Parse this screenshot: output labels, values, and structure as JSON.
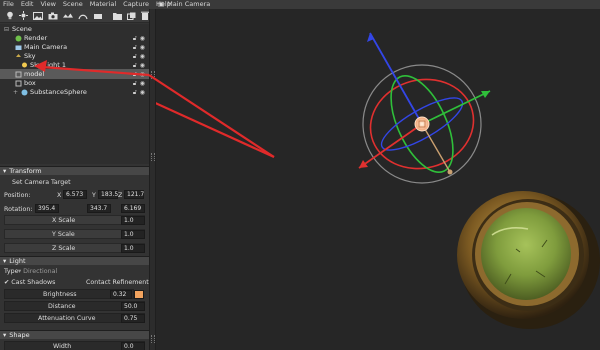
{
  "menu": [
    "File",
    "Edit",
    "View",
    "Scene",
    "Material",
    "Capture",
    "Help"
  ],
  "viewport": {
    "title": "Main Camera"
  },
  "tree": {
    "items": [
      {
        "label": "Scene"
      },
      {
        "label": "Render"
      },
      {
        "label": "Main Camera"
      },
      {
        "label": "Sky"
      },
      {
        "label": "Sky Light 1"
      },
      {
        "label": "model"
      },
      {
        "label": "box"
      },
      {
        "label": "SubstanceSphere"
      }
    ]
  },
  "transform": {
    "header": "Transform",
    "set_camera_target": "Set Camera Target",
    "position_label": "Position:",
    "rotation_label": "Rotation:",
    "x": "X",
    "y": "Y",
    "z": "Z",
    "position": [
      "6.573",
      "183.5",
      "121.7"
    ],
    "rotation": [
      "395.4",
      "343.7",
      "6.169"
    ],
    "scale_rows": [
      {
        "label": "X Scale",
        "value": "1.0"
      },
      {
        "label": "Y Scale",
        "value": "1.0"
      },
      {
        "label": "Z Scale",
        "value": "1.0"
      }
    ]
  },
  "light": {
    "header": "Light",
    "type_label": "Type",
    "type_value": "Directional",
    "cast_shadows": "Cast Shadows",
    "contact_refinement": "Contact Refinement",
    "brightness_label": "Brightness",
    "brightness_value": "0.32",
    "distance_label": "Distance",
    "distance_value": "50.0",
    "attenuation_label": "Attenuation Curve",
    "attenuation_value": "0.75",
    "swatch_color": "#f2a35e"
  },
  "shape": {
    "header": "Shape",
    "width_label": "Width",
    "width_value": "0.0"
  },
  "colors": {
    "gizmo_x": "#e0302f",
    "gizmo_y": "#2fbf3a",
    "gizmo_z": "#3346e6",
    "annotation_arrow": "#e02a2a"
  },
  "icons": [
    "light-bulb-icon",
    "light-icon",
    "photo-icon",
    "camera-icon",
    "move-icon",
    "rotate-icon",
    "scale-icon",
    "folder-icon",
    "duplicate-icon",
    "trash-icon",
    "gear-icon",
    "lock-icon",
    "eye-icon"
  ]
}
